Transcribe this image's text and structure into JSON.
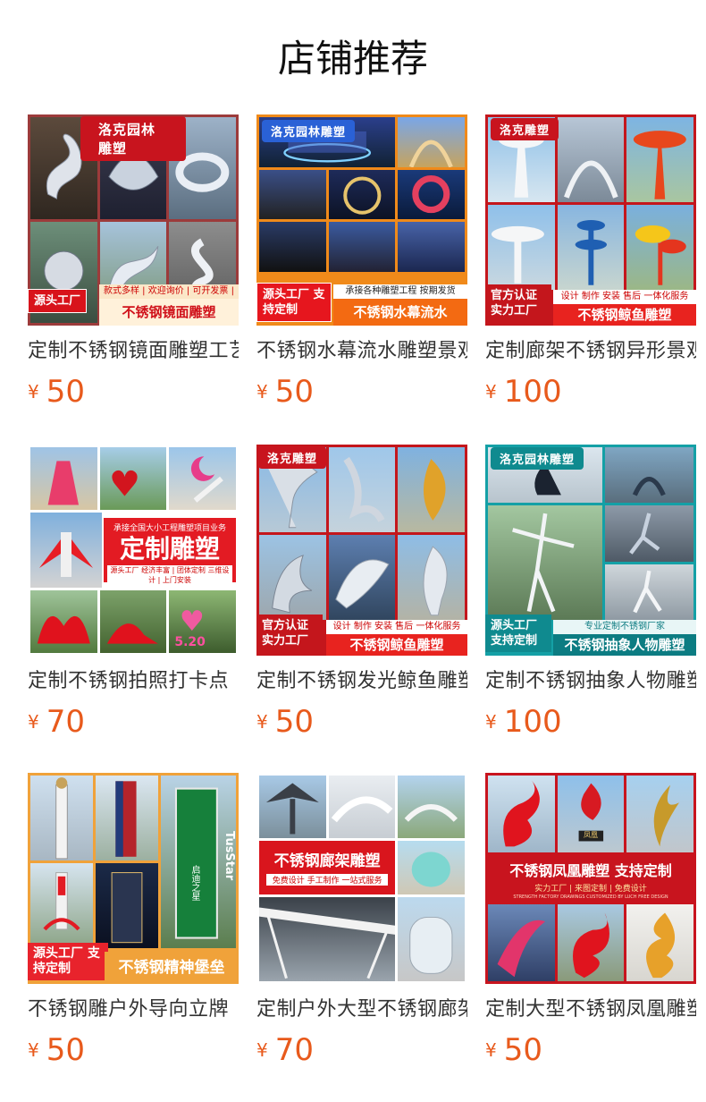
{
  "page": {
    "title": "店铺推荐"
  },
  "products": [
    {
      "name": "定制不锈钢镜面雕塑工艺品",
      "currency": "¥",
      "price": "50",
      "image": {
        "top_tag": "洛克园林雕塑",
        "left_badge": "源头工厂",
        "small_bar": "款式多样 | 欢迎询价 | 可开发票 | 实力商家",
        "bottom_bar": "不锈钢镜面雕塑"
      }
    },
    {
      "name": "不锈钢水幕流水雕塑景观",
      "currency": "¥",
      "price": "50",
      "image": {
        "top_tag": "洛克园林雕塑",
        "left_badge": "源头工厂 支持定制",
        "small_bar": "承接各种雕塑工程 按期发货",
        "bottom_bar": "不锈钢水幕流水"
      }
    },
    {
      "name": "定制廊架不锈钢异形景观",
      "currency": "¥",
      "price": "100",
      "image": {
        "top_tag": "洛克雕塑",
        "left_badge": "官方认证 实力工厂",
        "small_bar": "设计 制作 安装 售后 一体化服务",
        "bottom_bar": "不锈钢鲸鱼雕塑"
      }
    },
    {
      "name": "定制不锈钢拍照打卡点",
      "currency": "¥",
      "price": "70",
      "image": {
        "banner_small": "承接全国大小工程雕塑项目业务",
        "banner_big": "定制雕塑",
        "banner_items": "源头工厂 经济丰富 | 团体定制 三维设计 | 上门安装",
        "sign": "5.20"
      }
    },
    {
      "name": "定制不锈钢发光鲸鱼雕塑",
      "currency": "¥",
      "price": "50",
      "image": {
        "top_tag": "洛克雕塑",
        "left_badge": "官方认证 实力工厂",
        "small_bar": "设计 制作 安装 售后 一体化服务",
        "bottom_bar": "不锈钢鲸鱼雕塑"
      }
    },
    {
      "name": "定制不锈钢抽象人物雕塑",
      "currency": "¥",
      "price": "100",
      "image": {
        "top_tag": "洛克园林雕塑",
        "left_badge": "源头工厂 支持定制",
        "small_bar": "专业定制不锈钢厂家",
        "bottom_bar": "不锈钢抽象人物雕塑"
      }
    },
    {
      "name": "不锈钢雕户外导向立牌",
      "currency": "¥",
      "price": "50",
      "image": {
        "left_badge": "源头工厂 支持定制",
        "bottom_bar": "不锈钢精神堡垒",
        "sign_a": "TusStar",
        "sign_b": "启迪之星"
      }
    },
    {
      "name": "定制户外大型不锈钢廊架",
      "currency": "¥",
      "price": "70",
      "image": {
        "banner_big": "不锈钢廊架雕塑",
        "banner_small": "免费设计 手工制作 一站式服务"
      }
    },
    {
      "name": "定制大型不锈钢凤凰雕塑",
      "currency": "¥",
      "price": "50",
      "image": {
        "banner_big": "不锈钢凤凰雕塑 支持定制",
        "banner_small": "实力工厂 | 来图定制 | 免费设计",
        "banner_tiny": "STRENGTH FACTORY DRAWINGS CUSTOMIZED BY LUCH FREE DESIGN",
        "plaque": "凤凰"
      }
    }
  ],
  "colors": {
    "price": "#e85a1c",
    "accent_red": "#e81d25",
    "accent_orange": "#f36a12"
  }
}
